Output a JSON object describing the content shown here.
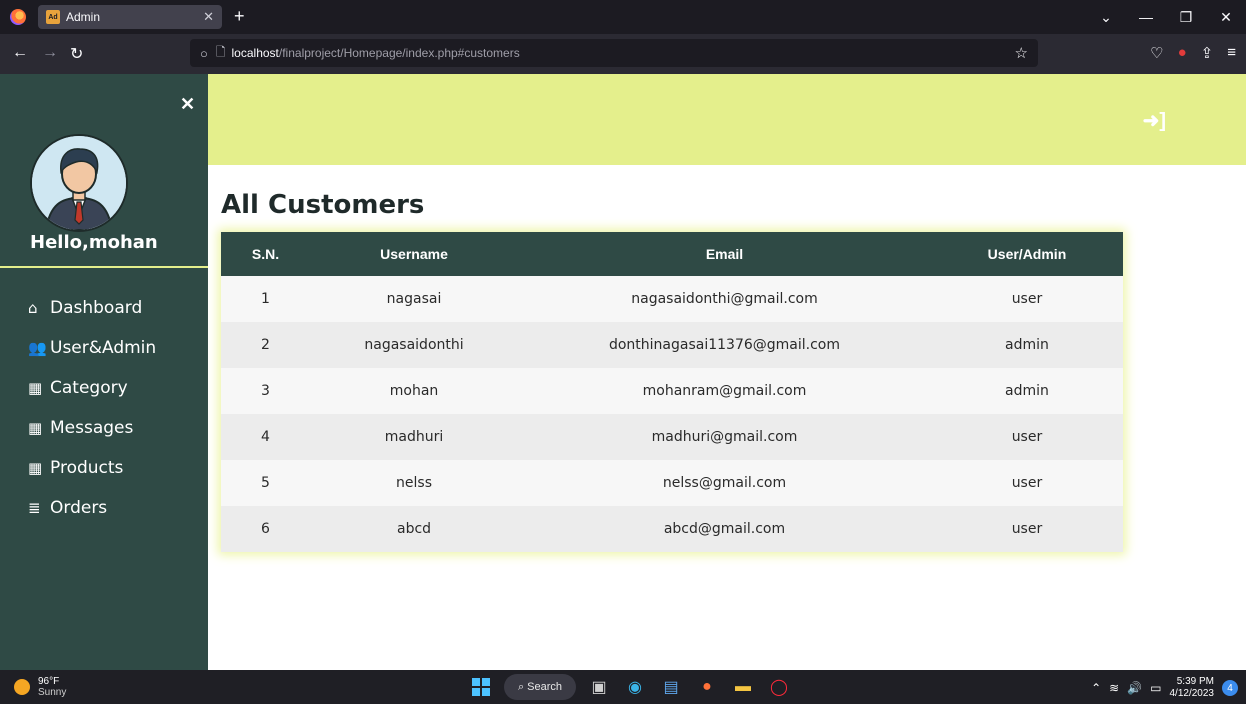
{
  "browser": {
    "tab_title": "Admin",
    "tab_favicon": "Ad",
    "url_host": "localhost",
    "url_path": "/finalproject/Homepage/index.php#customers"
  },
  "sidebar": {
    "greeting": "Hello,mohan",
    "items": [
      {
        "label": "Dashboard",
        "icon": "home-icon"
      },
      {
        "label": "User&Admin",
        "icon": "users-icon"
      },
      {
        "label": "Category",
        "icon": "grid-icon"
      },
      {
        "label": "Messages",
        "icon": "table-icon"
      },
      {
        "label": "Products",
        "icon": "table-icon"
      },
      {
        "label": "Orders",
        "icon": "list-icon"
      }
    ]
  },
  "main": {
    "title": "All Customers",
    "table": {
      "headers": [
        "S.N.",
        "Username",
        "Email",
        "User/Admin"
      ],
      "rows": [
        [
          "1",
          "nagasai",
          "nagasaidonthi@gmail.com",
          "user"
        ],
        [
          "2",
          "nagasaidonthi",
          "donthinagasai11376@gmail.com",
          "admin"
        ],
        [
          "3",
          "mohan",
          "mohanram@gmail.com",
          "admin"
        ],
        [
          "4",
          "madhuri",
          "madhuri@gmail.com",
          "user"
        ],
        [
          "5",
          "nelss",
          "nelss@gmail.com",
          "user"
        ],
        [
          "6",
          "abcd",
          "abcd@gmail.com",
          "user"
        ]
      ]
    }
  },
  "taskbar": {
    "temperature": "96°F",
    "weather": "Sunny",
    "search_label": "Search",
    "time": "5:39 PM",
    "date": "4/12/2023",
    "notification_count": "4"
  },
  "colors": {
    "sidebar": "#2f4a45",
    "header_band": "#e4ef8c",
    "table_header": "#2f4a45"
  }
}
